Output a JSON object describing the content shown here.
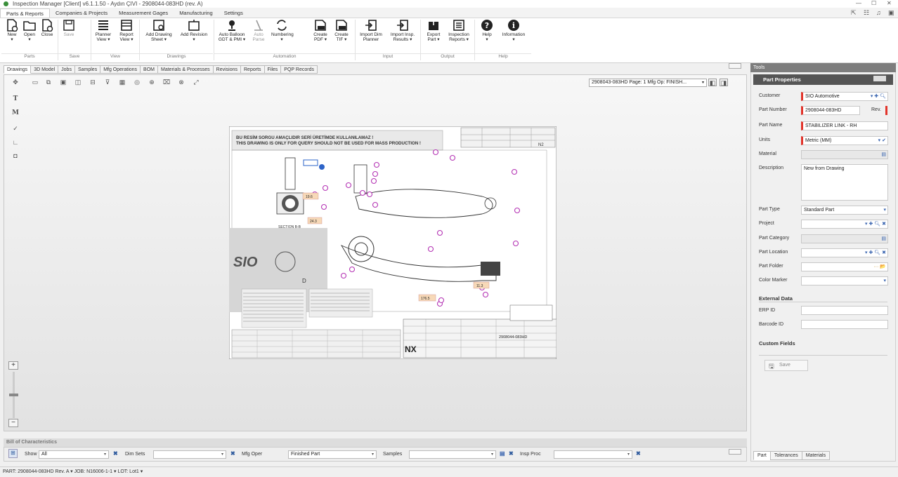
{
  "window": {
    "title": "Inspection Manager [Client] v6.1.1.50 - Aydın ÇIVI - 2908044-083HD (rev. A)"
  },
  "menu": {
    "tabs": [
      "Parts & Reports",
      "Companies & Projects",
      "Measurement Gages",
      "Manufacturing",
      "Settings"
    ]
  },
  "ribbon": {
    "buttons": [
      {
        "label": "New\n▾",
        "icon": "new-icon"
      },
      {
        "label": "Open\n▾",
        "icon": "open-icon"
      },
      {
        "label": "Close",
        "icon": "close-icon"
      },
      {
        "label": "Save",
        "icon": "save-icon"
      },
      {
        "label": "Planner\nView ▾",
        "icon": "planner-icon"
      },
      {
        "label": "Report\nView ▾",
        "icon": "report-icon"
      },
      {
        "label": "Add Drawing\nSheet ▾",
        "icon": "add-drawing-icon"
      },
      {
        "label": "Add Revision\n▾",
        "icon": "add-revision-icon"
      },
      {
        "label": "Auto Balloon\nGDT & PMI ▾",
        "icon": "balloon-icon"
      },
      {
        "label": "Auto Parse",
        "icon": "parse-icon"
      },
      {
        "label": "Numbering\n▾",
        "icon": "numbering-icon"
      },
      {
        "label": "Create\nPDF ▾",
        "icon": "pdf-icon"
      },
      {
        "label": "Create\nTIF ▾",
        "icon": "tif-icon"
      },
      {
        "label": "Import Dim\nPlanner",
        "icon": "import-dim-icon"
      },
      {
        "label": "Import Insp.\nResults ▾",
        "icon": "import-results-icon"
      },
      {
        "label": "Export\nPart ▾",
        "icon": "export-icon"
      },
      {
        "label": "Inspection\nReports ▾",
        "icon": "inspection-reports-icon"
      },
      {
        "label": "Help\n▾",
        "icon": "help-icon"
      },
      {
        "label": "Information\n▾",
        "icon": "info-icon"
      }
    ],
    "groups": [
      "Parts",
      "Save",
      "View",
      "Drawings",
      "Automation",
      "Input",
      "Output",
      "Help"
    ]
  },
  "doc_tabs": [
    "Drawings",
    "3D Model",
    "Jobs",
    "Samples",
    "Mfg Operations",
    "BOM",
    "Materials & Processes",
    "Revisions",
    "Reports",
    "Files",
    "PQP Records"
  ],
  "viewer": {
    "page_selector": "2908043-083HD Page: 1 Mfg Op: FINISH...",
    "side_tools": [
      "T",
      "M"
    ],
    "drawing_text": {
      "banner1": "BU RESİM SORGU AMAÇLIDIR SERİ ÜRETİMDE KULLANILAMAZ !",
      "banner2": "THIS DRAWING IS ONLY FOR QUERY SHOULD NOT BE USED FOR MASS PRODUCTION !",
      "section": "SECTION B-B",
      "detail": "D",
      "title_nx": "NX",
      "logo": "SIO",
      "part_no": "2908044-083HD",
      "sheet_code": "N2",
      "callouts": [
        "19.6",
        "24.3",
        "11.3",
        "176.5"
      ]
    }
  },
  "tools_panel": {
    "header": "Tools",
    "title": "Part Properties",
    "fields": {
      "customer": {
        "label": "Customer",
        "value": "SIO Automotive"
      },
      "part_number": {
        "label": "Part Number",
        "value": "2908044-083HD",
        "rev_label": "Rev."
      },
      "part_name": {
        "label": "Part Name",
        "value": "STABILIZER LINK - RH"
      },
      "units": {
        "label": "Units",
        "value": "Metric (MM)"
      },
      "material": {
        "label": "Material",
        "value": ""
      },
      "description": {
        "label": "Description",
        "value": "New from Drawing"
      },
      "part_type": {
        "label": "Part Type",
        "value": "Standard Part"
      },
      "project": {
        "label": "Project",
        "value": ""
      },
      "part_category": {
        "label": "Part Category",
        "value": ""
      },
      "part_location": {
        "label": "Part Location",
        "value": ""
      },
      "part_folder": {
        "label": "Part Folder",
        "value": ""
      },
      "color_marker": {
        "label": "Color Marker",
        "value": ""
      }
    },
    "external_data": {
      "title": "External Data",
      "erp_label": "ERP ID",
      "barcode_label": "Barcode ID"
    },
    "custom_fields": {
      "title": "Custom Fields"
    },
    "save_label": "Save",
    "bottom_tabs": [
      "Part",
      "Tolerances",
      "Materials"
    ]
  },
  "boc": {
    "title": "Bill of Characteristics",
    "show_label": "Show",
    "show_value": "All",
    "dimsets_label": "Dim Sets",
    "dimsets_value": "",
    "mfg_label": "Mfg Oper",
    "mfg_value": "Finished Part",
    "samples_label": "Samples",
    "samples_value": "",
    "insp_label": "Insp Proc",
    "insp_value": ""
  },
  "status": {
    "text": "PART: 2908044-083HD Rev. A  ▾  JOB: N16006-1-1  ▾  LOT: Lot1  ▾"
  },
  "colors": {
    "required": "#e2342b",
    "panel_header": "#555555",
    "accent": "#3a65b0"
  }
}
